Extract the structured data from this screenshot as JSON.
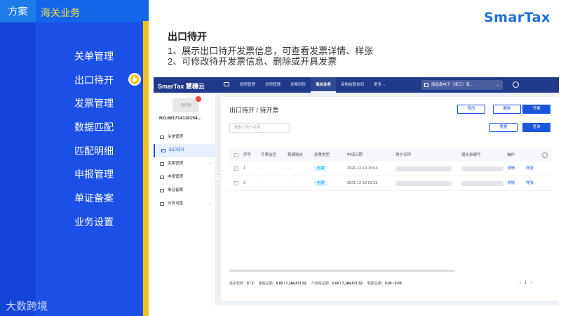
{
  "left_nav": {
    "top_tag": "方案",
    "title": "海关业务",
    "items": [
      "关单管理",
      "出口待开",
      "发票管理",
      "数据匹配",
      "匹配明细",
      "申报管理",
      "单证备案",
      "业务设置"
    ],
    "active_index": 1,
    "watermark": "大数跨境"
  },
  "header": {
    "brand": "SmarTax",
    "title": "出口待开",
    "lines": [
      "1、展示出口待开发票信息，可查看发票详情、样张",
      "2、可修改待开发票信息、删除或开具发票"
    ]
  },
  "app": {
    "logo": "SmarTax 慧穗云",
    "nav": [
      "销项管理",
      "进项管理",
      "发票风险",
      "海关业务",
      "采购结算协同",
      "更多"
    ],
    "nav_more_suffix": "⌄",
    "active_nav_index": 3,
    "company": "南昌鑫电子（浙江）有...",
    "sidebar": {
      "badge": "金税盘",
      "org_id": "NO.661714110154⌄",
      "items": [
        {
          "label": "关单管理",
          "has_chevron": false
        },
        {
          "label": "出口待开",
          "has_chevron": false
        },
        {
          "label": "发票管理",
          "has_chevron": true
        },
        {
          "label": "申报管理",
          "has_chevron": false
        },
        {
          "label": "单证备案",
          "has_chevron": false
        },
        {
          "label": "业务设置",
          "has_chevron": true
        }
      ],
      "active_index": 1
    },
    "content": {
      "breadcrumb": "出口待开 / 待开票",
      "buttons": {
        "edit": "修改",
        "delete": "删除",
        "issue": "开票",
        "reset": "重置",
        "search": "查询"
      },
      "search_placeholder": "请输入购方名称",
      "table": {
        "headers": [
          "序号",
          "开票监控",
          "税编缺失",
          "发票类型",
          "申请日期",
          "购方名称",
          "报关单编号",
          "操作"
        ],
        "rows": [
          {
            "no": "1",
            "monitor": "-",
            "tax_missing": "-",
            "type": "电票",
            "date": "2021-12-19 15:04",
            "detail": "详情",
            "sample": "样张"
          },
          {
            "no": "2",
            "monitor": "-",
            "tax_missing": "-",
            "type": "电票",
            "date": "2021-12-19 01:33",
            "detail": "详情",
            "sample": "样张"
          }
        ]
      },
      "footer": {
        "selected_label": "选中张数：",
        "selected_value": "0 / 2",
        "total_amount_label": "金税总额：",
        "total_amount_value": "0.00 / 7,184,571.52",
        "untaxed_label": "不含税总额：",
        "untaxed_value": "0.00 / 7,184,571.52",
        "tax_label": "税额总额：",
        "tax_value": "0.00 / 0.00"
      },
      "pager": {
        "prev": "‹",
        "page": "1",
        "next": "›"
      }
    }
  },
  "colors": {
    "left_panel": "#1a50e6",
    "accent_yellow": "#f2c21c",
    "app_topbar": "#1f3a8a",
    "primary": "#1a56db"
  }
}
